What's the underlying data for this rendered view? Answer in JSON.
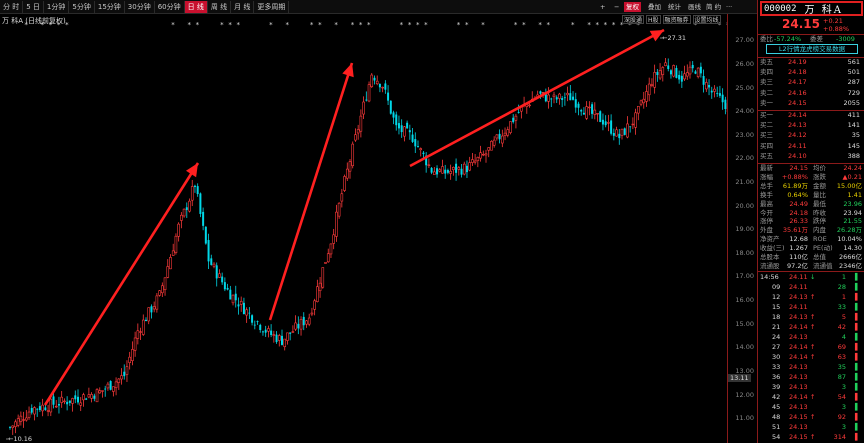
{
  "toolbar": {
    "tabs": [
      "分 时",
      "5 日",
      "1分钟",
      "5分钟",
      "15分钟",
      "30分钟",
      "60分钟",
      "日 线",
      "周 线",
      "月 线",
      "更多周期"
    ],
    "active_index": 7,
    "right_buttons": [
      "+",
      "−",
      "复权",
      "叠加",
      "统计",
      "画线",
      "简 约",
      "···"
    ]
  },
  "chart_title": "万 科A (日线前复权)",
  "indicator_row2": [
    "深股通",
    "H股",
    "融资融券",
    "设置均线"
  ],
  "y_axis_labels": [
    "27.00",
    "26.00",
    "25.00",
    "24.00",
    "23.00",
    "22.00",
    "21.00",
    "20.00",
    "19.00",
    "18.00",
    "17.00",
    "16.00",
    "15.00",
    "14.00",
    "13.00",
    "12.00",
    "11.00"
  ],
  "current_price_tag": "13.11",
  "annotations": {
    "high": "27.31",
    "low": "10.16"
  },
  "stock": {
    "code": "000002",
    "name": "万 科A",
    "price": "24.15",
    "change": "+0.21",
    "change_pct": "+0.88%"
  },
  "ratio": {
    "label1": "委比",
    "value1": "-57.24%",
    "label2": "委差",
    "value2": "-3009"
  },
  "stat_button": "L2行情龙虎榜交易数据",
  "asks": [
    {
      "label": "卖五",
      "price": "24.19",
      "vol": "561"
    },
    {
      "label": "卖四",
      "price": "24.18",
      "vol": "501"
    },
    {
      "label": "卖三",
      "price": "24.17",
      "vol": "287"
    },
    {
      "label": "卖二",
      "price": "24.16",
      "vol": "729"
    },
    {
      "label": "卖一",
      "price": "24.15",
      "vol": "2055"
    }
  ],
  "bids": [
    {
      "label": "买一",
      "price": "24.14",
      "vol": "411"
    },
    {
      "label": "买二",
      "price": "24.13",
      "vol": "141"
    },
    {
      "label": "买三",
      "price": "24.12",
      "vol": "35"
    },
    {
      "label": "买四",
      "price": "24.11",
      "vol": "145"
    },
    {
      "label": "买五",
      "price": "24.10",
      "vol": "388"
    }
  ],
  "quote": [
    {
      "l1": "最新",
      "v1": "24.15",
      "c1": "red",
      "l2": "均价",
      "v2": "24.24",
      "c2": "red"
    },
    {
      "l1": "涨幅",
      "v1": "+0.88%",
      "c1": "red",
      "l2": "涨跌",
      "v2": "▲0.21",
      "c2": "red"
    },
    {
      "l1": "总手",
      "v1": "61.89万",
      "c1": "yel",
      "l2": "金额",
      "v2": "15.00亿",
      "c2": "yel"
    },
    {
      "l1": "换手",
      "v1": "0.64%",
      "c1": "yel",
      "l2": "量比",
      "v2": "1.41",
      "c2": "yel"
    },
    {
      "l1": "最高",
      "v1": "24.49",
      "c1": "red",
      "l2": "最低",
      "v2": "23.96",
      "c2": "green"
    },
    {
      "l1": "今开",
      "v1": "24.18",
      "c1": "red",
      "l2": "昨收",
      "v2": "23.94",
      "c2": "wht"
    },
    {
      "l1": "涨停",
      "v1": "26.33",
      "c1": "red",
      "l2": "跌停",
      "v2": "21.55",
      "c2": "green"
    },
    {
      "l1": "外盘",
      "v1": "35.61万",
      "c1": "red",
      "l2": "内盘",
      "v2": "26.28万",
      "c2": "green"
    },
    {
      "l1": "净资产",
      "v1": "12.68",
      "c1": "wht",
      "l2": "ROE",
      "v2": "10.04%",
      "c2": "wht"
    },
    {
      "l1": "收益(三)",
      "v1": "1.267",
      "c1": "wht",
      "l2": "PE(动)",
      "v2": "14.30",
      "c2": "wht"
    },
    {
      "l1": "总股本",
      "v1": "110亿",
      "c1": "wht",
      "l2": "总值",
      "v2": "2666亿",
      "c2": "wht"
    },
    {
      "l1": "流通股",
      "v1": "97.2亿",
      "c1": "wht",
      "l2": "流通值",
      "v2": "2346亿",
      "c2": "wht"
    }
  ],
  "trades": [
    {
      "t": "14:56",
      "p": "24.11",
      "arrow": "↓",
      "v": "1",
      "d": "S"
    },
    {
      "t": "09",
      "p": "24.11",
      "arrow": "",
      "v": "28",
      "d": "S"
    },
    {
      "t": "12",
      "p": "24.13",
      "arrow": "↑",
      "v": "1",
      "d": "B"
    },
    {
      "t": "15",
      "p": "24.11",
      "arrow": "",
      "v": "33",
      "d": "S"
    },
    {
      "t": "18",
      "p": "24.13",
      "arrow": "↑",
      "v": "5",
      "d": "B"
    },
    {
      "t": "21",
      "p": "24.14",
      "arrow": "↑",
      "v": "42",
      "d": "B"
    },
    {
      "t": "24",
      "p": "24.13",
      "arrow": "",
      "v": "4",
      "d": "S"
    },
    {
      "t": "27",
      "p": "24.14",
      "arrow": "↑",
      "v": "69",
      "d": "B"
    },
    {
      "t": "30",
      "p": "24.14",
      "arrow": "↑",
      "v": "63",
      "d": "B"
    },
    {
      "t": "33",
      "p": "24.13",
      "arrow": "",
      "v": "35",
      "d": "S"
    },
    {
      "t": "36",
      "p": "24.13",
      "arrow": "",
      "v": "87",
      "d": "S"
    },
    {
      "t": "39",
      "p": "24.13",
      "arrow": "",
      "v": "3",
      "d": "S"
    },
    {
      "t": "42",
      "p": "24.14",
      "arrow": "↑",
      "v": "54",
      "d": "B"
    },
    {
      "t": "45",
      "p": "24.13",
      "arrow": "",
      "v": "3",
      "d": "S"
    },
    {
      "t": "48",
      "p": "24.15",
      "arrow": "↑",
      "v": "92",
      "d": "B"
    },
    {
      "t": "51",
      "p": "24.13",
      "arrow": "",
      "v": "3",
      "d": "S"
    },
    {
      "t": "54",
      "p": "24.15",
      "arrow": "↑",
      "v": "314",
      "d": "B"
    }
  ],
  "colors": {
    "up": "#ff3b3b",
    "down": "#21d05b",
    "candle_down": "#00d8e8",
    "arrow": "#ff2020",
    "border": "#8b1a1a"
  }
}
